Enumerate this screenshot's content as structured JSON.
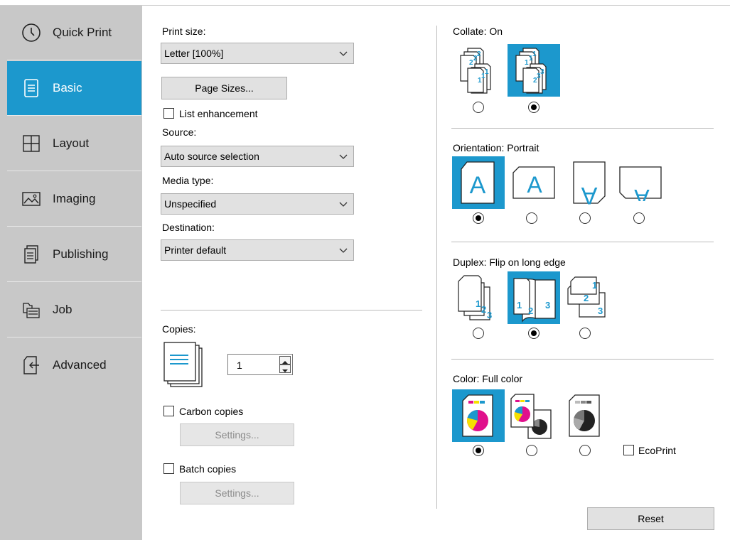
{
  "sidebar": {
    "items": [
      {
        "label": "Quick Print",
        "icon": "clock-icon",
        "active": false
      },
      {
        "label": "Basic",
        "icon": "document-icon",
        "active": true
      },
      {
        "label": "Layout",
        "icon": "grid-icon",
        "active": false
      },
      {
        "label": "Imaging",
        "icon": "image-icon",
        "active": false
      },
      {
        "label": "Publishing",
        "icon": "pages-icon",
        "active": false
      },
      {
        "label": "Job",
        "icon": "job-stack-icon",
        "active": false
      },
      {
        "label": "Advanced",
        "icon": "advanced-arrow-icon",
        "active": false
      }
    ]
  },
  "basic": {
    "print_size_label": "Print size:",
    "print_size_value": "Letter  [100%]",
    "page_sizes_button": "Page Sizes...",
    "list_enhancement_label": "List enhancement",
    "list_enhancement_checked": false,
    "source_label": "Source:",
    "source_value": "Auto source selection",
    "media_type_label": "Media type:",
    "media_type_value": "Unspecified",
    "destination_label": "Destination:",
    "destination_value": "Printer default",
    "copies_label": "Copies:",
    "copies_value": "1",
    "carbon_copies_label": "Carbon copies",
    "carbon_copies_checked": false,
    "carbon_settings_button": "Settings...",
    "batch_copies_label": "Batch copies",
    "batch_copies_checked": false,
    "batch_settings_button": "Settings..."
  },
  "collate": {
    "label": "Collate:  On",
    "selected": 1
  },
  "orientation": {
    "label": "Orientation:  Portrait",
    "selected": 0,
    "glyph": "A"
  },
  "duplex": {
    "label": "Duplex:  Flip on long edge",
    "selected": 1
  },
  "color": {
    "label": "Color:  Full color",
    "selected": 0,
    "ecoprint_label": "EcoPrint",
    "ecoprint_checked": false
  },
  "reset_button": "Reset",
  "colors": {
    "accent": "#1c98cd",
    "sidebar": "#c8c8c8",
    "magenta": "#e0108c",
    "yellow": "#f5e000",
    "cyan": "#1c98cd"
  }
}
